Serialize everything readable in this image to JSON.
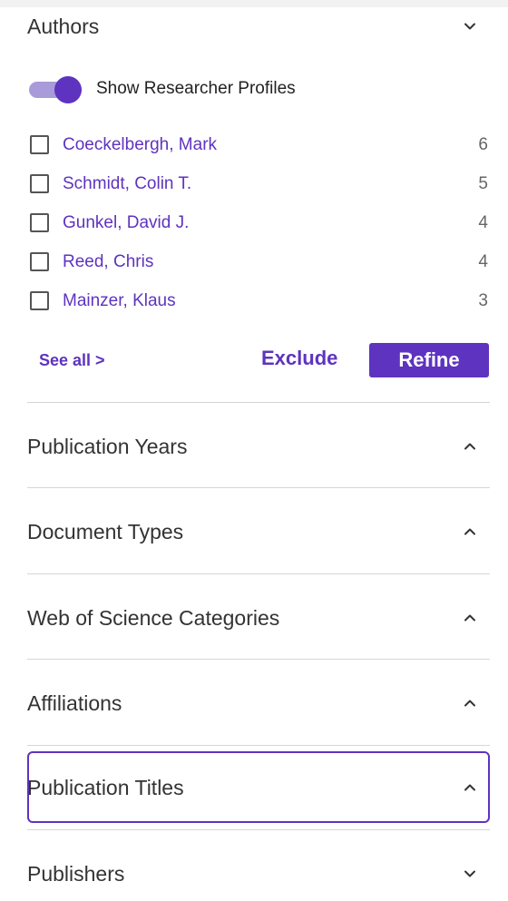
{
  "authors": {
    "title": "Authors",
    "toggle_label": "Show Researcher Profiles",
    "toggle_on": true,
    "items": [
      {
        "name": "Coeckelbergh, Mark",
        "count": "6"
      },
      {
        "name": "Schmidt, Colin T.",
        "count": "5"
      },
      {
        "name": "Gunkel, David J.",
        "count": "4"
      },
      {
        "name": "Reed, Chris",
        "count": "4"
      },
      {
        "name": "Mainzer, Klaus",
        "count": "3"
      }
    ],
    "see_all": "See all >",
    "exclude": "Exclude",
    "refine": "Refine"
  },
  "facets": [
    {
      "label": "Publication Years",
      "chevron": "up"
    },
    {
      "label": "Document Types",
      "chevron": "up"
    },
    {
      "label": "Web of Science Categories",
      "chevron": "up"
    },
    {
      "label": "Affiliations",
      "chevron": "up"
    },
    {
      "label": "Publication Titles",
      "chevron": "up",
      "focused": true
    },
    {
      "label": "Publishers",
      "chevron": "down"
    }
  ],
  "colors": {
    "accent": "#5e33bf",
    "toggle_track": "#a99ad9",
    "divider": "#d6d6d6",
    "text": "#333333"
  }
}
